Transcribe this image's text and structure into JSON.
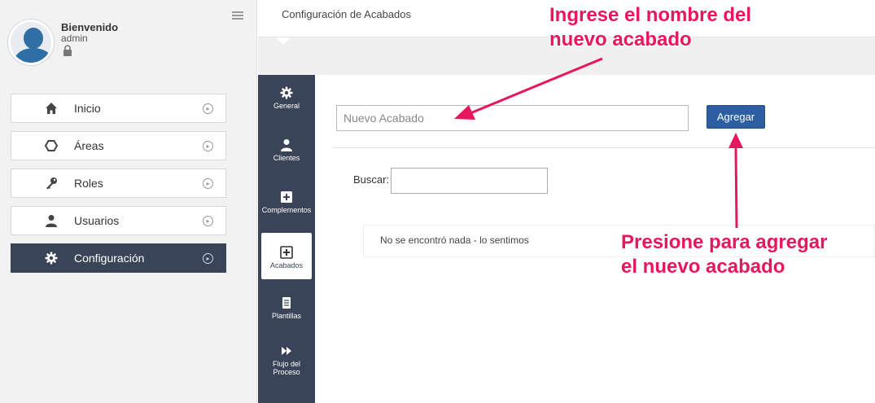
{
  "user": {
    "greeting": "Bienvenido",
    "name": "admin"
  },
  "sidebar": {
    "items": [
      {
        "label": "Inicio",
        "icon": "home-icon"
      },
      {
        "label": "Áreas",
        "icon": "hexagon-icon"
      },
      {
        "label": "Roles",
        "icon": "key-icon"
      },
      {
        "label": "Usuarios",
        "icon": "user-icon"
      },
      {
        "label": "Configuración",
        "icon": "gear-icon",
        "active": true
      }
    ]
  },
  "header": {
    "title": "Configuración de Acabados"
  },
  "tabs": [
    {
      "label": "General",
      "icon": "gear-icon"
    },
    {
      "label": "Clientes",
      "icon": "user-icon"
    },
    {
      "label": "Complementos",
      "icon": "plus-square-icon"
    },
    {
      "label": "Acabados",
      "icon": "plus-square-icon",
      "active": true
    },
    {
      "label": "Plantillas",
      "icon": "document-icon"
    },
    {
      "label": "Flujo del Proceso",
      "icon": "fast-forward-icon"
    }
  ],
  "form": {
    "new_placeholder": "Nuevo Acabado",
    "add_label": "Agregar",
    "search_label": "Buscar:",
    "empty_message": "No se encontró nada - lo sentimos"
  },
  "annotations": {
    "input_hint_line1": "Ingrese el nombre del",
    "input_hint_line2": "nuevo acabado",
    "button_hint_line1": "Presione para agregar",
    "button_hint_line2": "el nuevo acabado"
  },
  "colors": {
    "accent": "#2d5ea2",
    "sidebar_dark": "#3a4458",
    "annotation": "#e8175d"
  }
}
